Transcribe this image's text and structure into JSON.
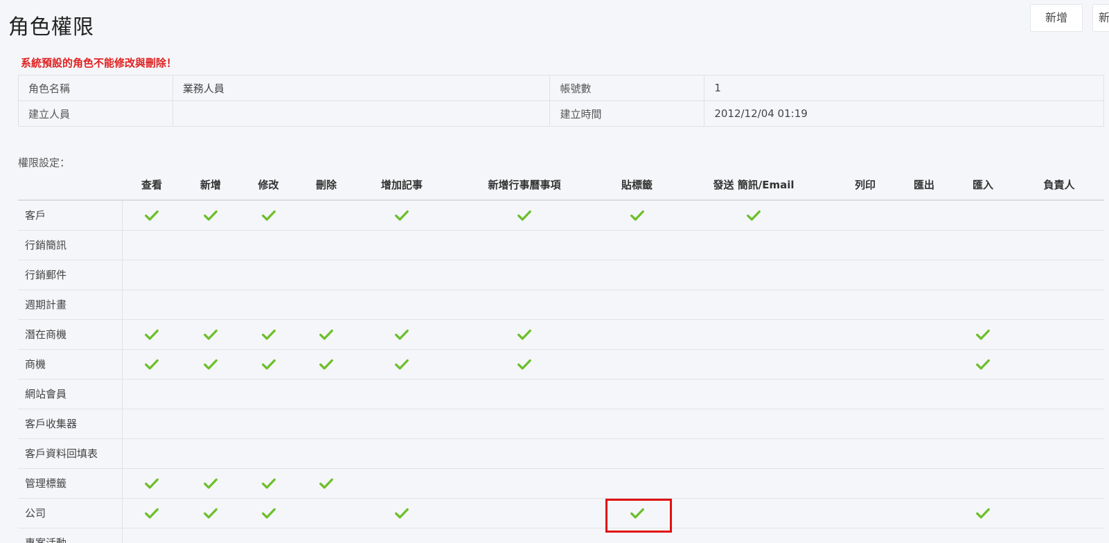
{
  "page": {
    "title": "角色權限",
    "buttons": {
      "add": "新增",
      "next": "新"
    },
    "warning": "系統預設的角色不能修改與刪除！"
  },
  "info": {
    "role_name_label": "角色名稱",
    "role_name_value": "業務人員",
    "account_count_label": "帳號數",
    "account_count_value": "1",
    "creator_label": "建立人員",
    "creator_value": "",
    "created_time_label": "建立時間",
    "created_time_value": "2012/12/04 01:19"
  },
  "permissions": {
    "section_label": "權限設定：",
    "columns": [
      "查看",
      "新增",
      "修改",
      "刪除",
      "增加記事",
      "新增行事曆事項",
      "貼標籤",
      "發送 簡訊/Email",
      "列印",
      "匯出",
      "匯入",
      "負責人"
    ],
    "rows": [
      {
        "name": "客戶",
        "checks": [
          true,
          true,
          true,
          false,
          true,
          true,
          true,
          true,
          false,
          false,
          false,
          false
        ]
      },
      {
        "name": "行銷簡訊",
        "checks": [
          false,
          false,
          false,
          false,
          false,
          false,
          false,
          false,
          false,
          false,
          false,
          false
        ]
      },
      {
        "name": "行銷郵件",
        "checks": [
          false,
          false,
          false,
          false,
          false,
          false,
          false,
          false,
          false,
          false,
          false,
          false
        ]
      },
      {
        "name": "週期計畫",
        "checks": [
          false,
          false,
          false,
          false,
          false,
          false,
          false,
          false,
          false,
          false,
          false,
          false
        ]
      },
      {
        "name": "潛在商機",
        "checks": [
          true,
          true,
          true,
          true,
          true,
          true,
          false,
          false,
          false,
          false,
          true,
          false
        ]
      },
      {
        "name": "商機",
        "checks": [
          true,
          true,
          true,
          true,
          true,
          true,
          false,
          false,
          false,
          false,
          true,
          false
        ]
      },
      {
        "name": "網站會員",
        "checks": [
          false,
          false,
          false,
          false,
          false,
          false,
          false,
          false,
          false,
          false,
          false,
          false
        ]
      },
      {
        "name": "客戶收集器",
        "checks": [
          false,
          false,
          false,
          false,
          false,
          false,
          false,
          false,
          false,
          false,
          false,
          false
        ]
      },
      {
        "name": "客戶資料回填表",
        "checks": [
          false,
          false,
          false,
          false,
          false,
          false,
          false,
          false,
          false,
          false,
          false,
          false
        ]
      },
      {
        "name": "管理標籤",
        "checks": [
          true,
          true,
          true,
          true,
          false,
          false,
          false,
          false,
          false,
          false,
          false,
          false
        ]
      },
      {
        "name": "公司",
        "checks": [
          true,
          true,
          true,
          false,
          true,
          false,
          true,
          false,
          false,
          false,
          true,
          false
        ],
        "highlight_col": 6
      },
      {
        "name": "專案活動",
        "checks": [
          false,
          false,
          false,
          false,
          false,
          false,
          false,
          false,
          false,
          false,
          false,
          false
        ]
      }
    ],
    "check_color": "#6cbf2a",
    "highlight_color": "#e01010"
  }
}
